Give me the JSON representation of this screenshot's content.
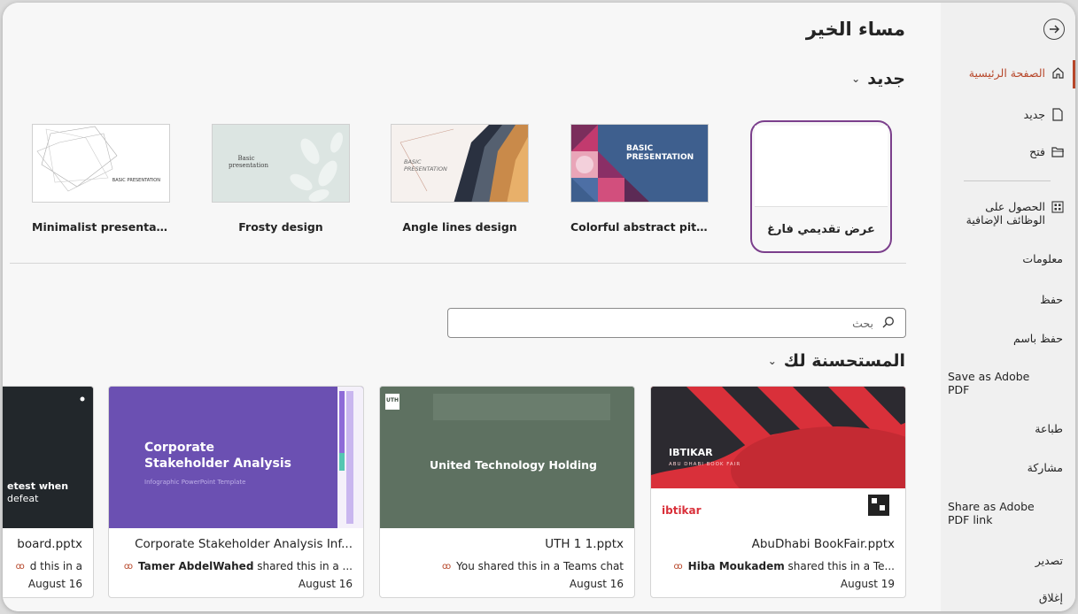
{
  "colors": {
    "accent": "#b7472a",
    "selection": "#7b3f8c",
    "sidebar_bg": "#f0f0f0",
    "main_bg": "#f7f7f7"
  },
  "greeting": "مساء الخير",
  "sidebar": {
    "items": [
      {
        "label": "الصفحة الرئيسية",
        "icon": "home-icon"
      },
      {
        "label": "جديد",
        "icon": "new-document-icon"
      },
      {
        "label": "فتح",
        "icon": "folder-open-icon"
      },
      {
        "label": "الحصول على الوظائف الإضافية",
        "icon": "add-ins-icon"
      }
    ],
    "text_items": [
      "معلومات",
      "حفظ",
      "حفظ باسم",
      "Save as Adobe PDF",
      "طباعة",
      "مشاركة",
      "Share as Adobe PDF link",
      "تصدير",
      "إغلاق"
    ]
  },
  "new_section": {
    "title": "جديد",
    "templates": [
      {
        "label": "عرض تقديمي فارغ"
      },
      {
        "label": "Colorful abstract pitch d...",
        "thumb_text": "BASIC PRESENTATION"
      },
      {
        "label": "Angle lines design",
        "thumb_text": "BASIC PRESENTATION"
      },
      {
        "label": "Frosty design",
        "thumb_text": "Basic presentation"
      },
      {
        "label": "Minimalist presentation",
        "thumb_text": "BASIC PRESENTATION"
      }
    ]
  },
  "search": {
    "placeholder": "بحث"
  },
  "recommended": {
    "title": "المستحسنة لك",
    "cards": [
      {
        "name": "AbuDhabi BookFair.pptx",
        "who": "Hiba Moukadem",
        "share": " shared this in a Te...",
        "date": "August 19",
        "thumb_title": "IBTIKAR",
        "thumb_sub": "ABU DHABI BOOK FAIR",
        "logo": "ibtikar"
      },
      {
        "name": "UTH 1 1.pptx",
        "who": "",
        "share": "You shared this in a Teams chat",
        "date": "August 16",
        "thumb_title": "United Technology Holding",
        "badge": "UTH"
      },
      {
        "name": "Corporate Stakeholder Analysis Inf...",
        "who": "Tamer AbdelWahed",
        "share": " shared this in a ...",
        "date": "August 16",
        "thumb_title_1": "Corporate",
        "thumb_title_2": "Stakeholder Analysis",
        "thumb_sub": "Infographic PowerPoint Template"
      },
      {
        "name": "board.pptx",
        "who": "",
        "share": "d this in a",
        "date": "August 16",
        "thumb_title": "etest when",
        "thumb_sub": "defeat"
      }
    ]
  }
}
